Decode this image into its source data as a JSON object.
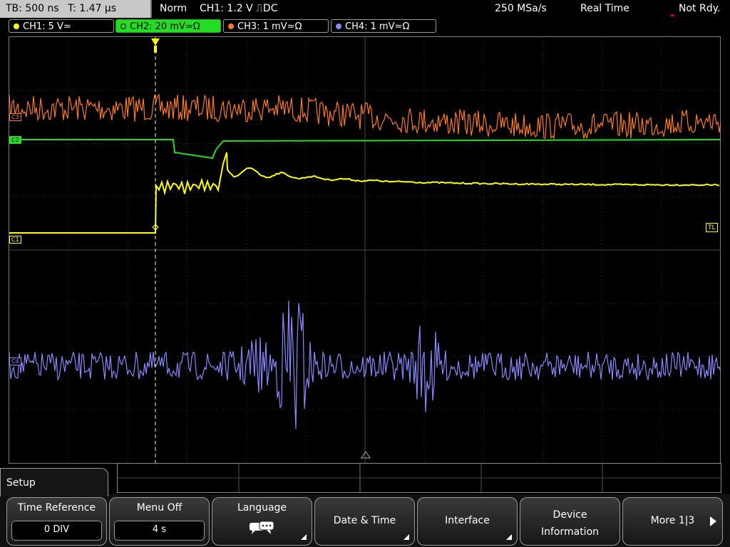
{
  "header": {
    "timebase": "TB: 500 ns",
    "time_pos": "T: 1.47 µs",
    "trigger_mode": "Norm",
    "trigger_info": "CH1: 1.2 V ⎍DC",
    "sample_rate": "250 MSa/s",
    "acq_mode": "Real Time",
    "status": "Not Rdy."
  },
  "channels": [
    {
      "label": "CH1: 5 V≃",
      "color": "#ffff00"
    },
    {
      "label": "CH2: 20 mV≃Ω",
      "color": "#22dd22"
    },
    {
      "label": "CH3: 1 mV≃Ω",
      "color": "#ff7a20"
    },
    {
      "label": "CH4: 1 mV≃Ω",
      "color": "#8888ff"
    }
  ],
  "markers": {
    "ch1": "C1",
    "ch2": "C2",
    "ch3": "C3",
    "ch4": "C4",
    "trigger_level": "TL",
    "trigger_pos": "T"
  },
  "menu": {
    "title": "Setup",
    "softkeys": [
      {
        "label": "Time Reference",
        "value": "0 DIV"
      },
      {
        "label": "Menu Off",
        "value": "4 s"
      },
      {
        "label": "Language",
        "icon": "speech-bubbles-icon"
      },
      {
        "label": "Date & Time"
      },
      {
        "label": "Interface"
      },
      {
        "label": "Device Information"
      },
      {
        "label": "More 1|3"
      }
    ]
  }
}
